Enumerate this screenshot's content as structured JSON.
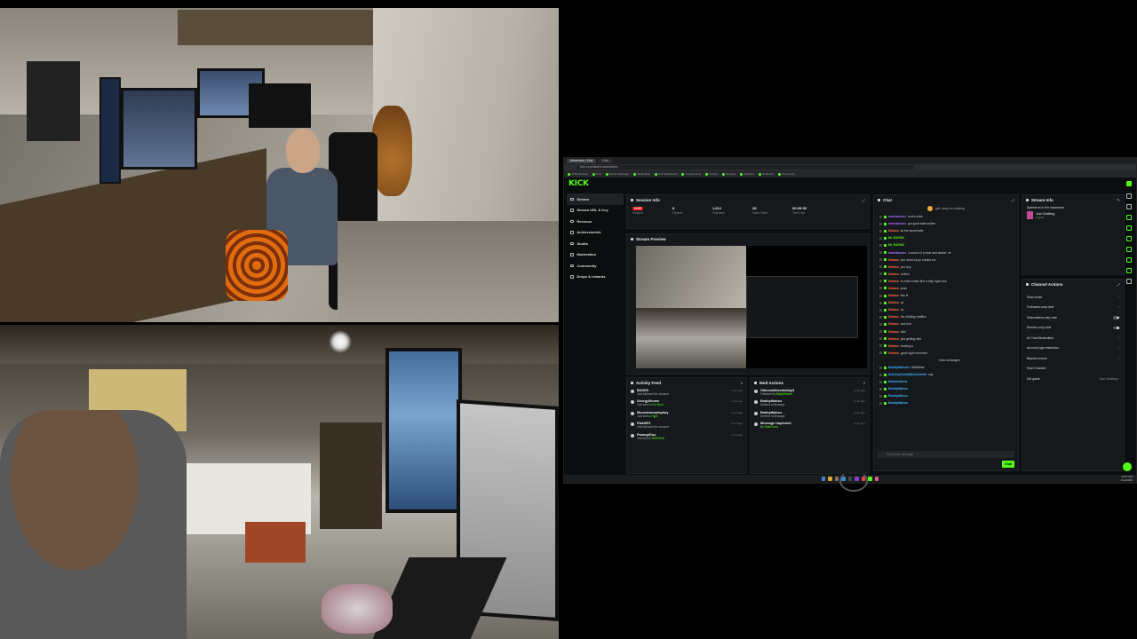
{
  "browser": {
    "tabs": [
      "Moderator | Kick",
      "Kick"
    ],
    "url": "kick.com/dashboard/stream",
    "bookmarks": [
      "All Bookmarks",
      "Kick",
      "Stream Manager",
      "Moderation",
      "Kick Dashboard",
      "Creator Tools",
      "Emotes",
      "Settings",
      "Analytics",
      "Schedule",
      "Community"
    ]
  },
  "kick": {
    "logo": "KICK",
    "nav": [
      {
        "label": "Stream",
        "active": true
      },
      {
        "label": "Stream URL & Key"
      },
      {
        "label": "Revenue"
      },
      {
        "label": "Achievements"
      },
      {
        "label": "Studio"
      },
      {
        "label": "Moderation"
      },
      {
        "label": "Community"
      },
      {
        "label": "Drops & rewards"
      }
    ],
    "session": {
      "title": "Session Info",
      "stats": [
        {
          "value": "LIVE",
          "label": "Session"
        },
        {
          "value": "8",
          "label": "Viewers"
        },
        {
          "value": "1,612",
          "label": "Followers"
        },
        {
          "value": "28",
          "label": "Subs Gifted"
        },
        {
          "value": "00:09:53",
          "label": "Time Live"
        }
      ]
    },
    "preview": {
      "title": "Stream Preview"
    },
    "activity": {
      "title": "Activity Feed",
      "items": [
        {
          "name": "BASSS",
          "desc": "Just followed the channel",
          "time": "1 min ago"
        },
        {
          "name": "GeorgyBrown",
          "desc": "Just sent a",
          "highlight": "Full Send",
          "time": "1 min ago"
        },
        {
          "name": "Moonshaneplayboy",
          "desc": "Just sent a",
          "highlight": "Hype",
          "time": "2 min ago"
        },
        {
          "name": "Flaki8F3",
          "desc": "Just followed the channel",
          "time": "3 min ago"
        },
        {
          "name": "ParangiGuy",
          "desc": "Just sent a",
          "highlight": "Skull Emit",
          "time": "4 min ago"
        }
      ]
    },
    "mod": {
      "title": "Mod Actions",
      "items": [
        {
          "name": "OkloosaSlicedwidget",
          "desc": "Followed by",
          "highlight": "BallyWhisker",
          "time": "9 min ago"
        },
        {
          "name": "BobbyWalrus",
          "desc": "Deleted a Message",
          "time": "9 min ago"
        },
        {
          "name": "BobbyWalrus",
          "desc": "Deleted a Message",
          "time": "9 min ago"
        },
        {
          "name": "Message Unpinned",
          "desc": "By",
          "highlight": "RainCloud",
          "time": "9 min ago"
        }
      ]
    },
    "chat": {
      "title": "Chat",
      "pinned": "gift: keep on chatting",
      "messages": [
        {
          "user": "moritzbeans",
          "color": "u",
          "text": "cool's cube"
        },
        {
          "user": "moritzbeans",
          "color": "u",
          "text": "got good fade snifter"
        },
        {
          "user": "Mufasa",
          "color": "u o",
          "text": "its the abominate"
        },
        {
          "user": "Mr_BAYNG",
          "color": "u g",
          "text": ""
        },
        {
          "user": "Mr_BAYNG",
          "color": "u g",
          "text": ""
        },
        {
          "user": "moritzbeans",
          "color": "u",
          "text": "Lucoco's 5 pi star and stinkin' vit"
        },
        {
          "user": "Mufasa",
          "color": "u o",
          "text": "you need a pop smoke sm"
        },
        {
          "user": "Mufasa",
          "color": "u o",
          "text": "you buy"
        },
        {
          "user": "Mufasa",
          "color": "u o",
          "text": "a bitch"
        },
        {
          "user": "Mufasa",
          "color": "u o",
          "text": "in chick bustin like a tulip right now"
        },
        {
          "user": "Mufasa",
          "color": "u o",
          "text": "yeah"
        },
        {
          "user": "Mufasa",
          "color": "u o",
          "text": "this ill"
        },
        {
          "user": "Mufasa",
          "color": "u o",
          "text": "ok"
        },
        {
          "user": "Mufasa",
          "color": "u o",
          "text": "ok"
        },
        {
          "user": "Mufasa",
          "color": "u o",
          "text": "the riddling chaffins"
        },
        {
          "user": "Mufasa",
          "color": "u o",
          "text": "and mor"
        },
        {
          "user": "Mufasa",
          "color": "u o",
          "text": "wild"
        },
        {
          "user": "Mufasa",
          "color": "u o",
          "text": "yea getting wild"
        },
        {
          "user": "Mufasa",
          "color": "u o",
          "text": "booting a"
        },
        {
          "user": "Mufasa",
          "color": "u o",
          "text": "good night recorded"
        },
        {
          "user": "",
          "color": "u g",
          "text": "New messages"
        },
        {
          "user": "BobbyWalrus4",
          "color": "u b",
          "text": "GiftUltime"
        },
        {
          "user": "AnthonyCandyBlockvdelta",
          "color": "u b",
          "text": "say"
        },
        {
          "user": "MissfireAnna",
          "color": "u b",
          "text": ""
        },
        {
          "user": "BobbyWalrus",
          "color": "u b",
          "text": ""
        },
        {
          "user": "BobbyWalrus",
          "color": "u b",
          "text": ""
        },
        {
          "user": "BobbyWalrus",
          "color": "u b",
          "text": ""
        }
      ],
      "input_placeholder": "Enter your message",
      "send_label": "Chat"
    },
    "streaminfo": {
      "title": "Stream Info",
      "stream_title": "Speedrun in the basement",
      "category": "Just Chatting",
      "language": "English"
    },
    "actions": {
      "title": "Channel Actions",
      "items": [
        {
          "label": "Slow mode",
          "right": "›"
        },
        {
          "label": "Followers-only chat",
          "right": "›"
        },
        {
          "label": "Subscribers-only chat",
          "right": "toggle"
        },
        {
          "label": "Emotes-only chat",
          "right": "toggle"
        },
        {
          "label": "AI Chat Moderation",
          "right": "›"
        },
        {
          "label": "Account age restriction",
          "right": "›"
        },
        {
          "label": "Banned words",
          "right": "›"
        },
        {
          "label": "Host Channel",
          "right": ""
        },
        {
          "label": "Set game",
          "right": "Just Chatting ›"
        }
      ]
    },
    "taskbar": {
      "time": "10:57 PM",
      "date": "1/14/2025"
    }
  }
}
